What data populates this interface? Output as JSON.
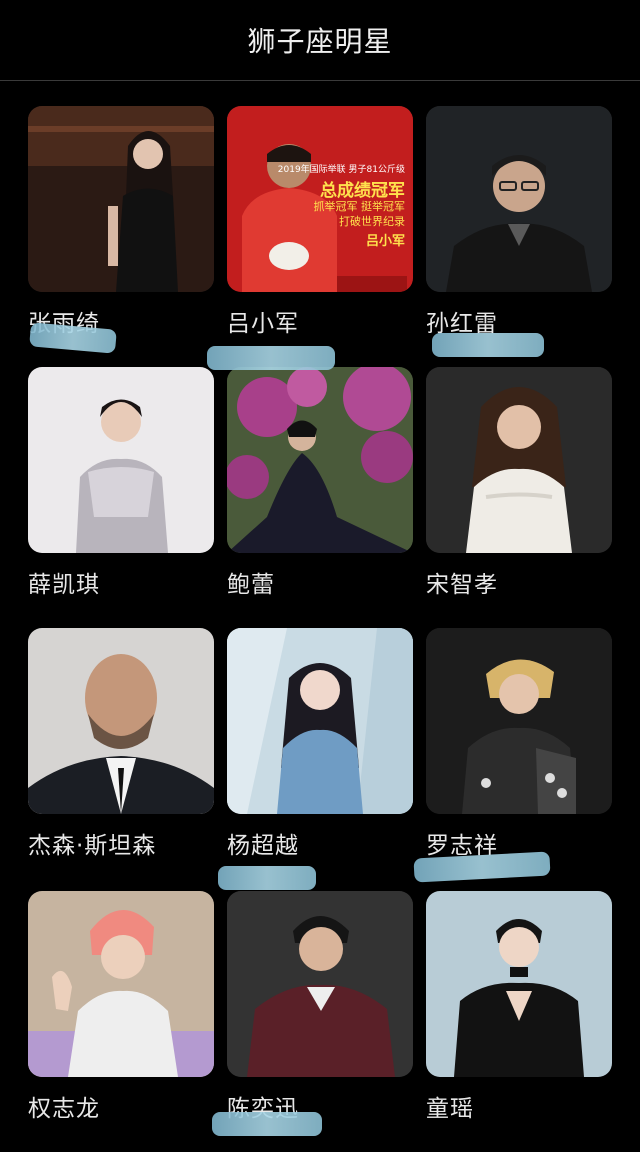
{
  "header": {
    "title": "狮子座明星"
  },
  "celebrities": [
    {
      "name": "张雨绮"
    },
    {
      "name": "吕小军"
    },
    {
      "name": "孙红雷"
    },
    {
      "name": "薛凯琪"
    },
    {
      "name": "鲍蕾"
    },
    {
      "name": "宋智孝"
    },
    {
      "name": "杰森·斯坦森"
    },
    {
      "name": "杨超越"
    },
    {
      "name": "罗志祥"
    },
    {
      "name": "权志龙"
    },
    {
      "name": "陈奕迅"
    },
    {
      "name": "童瑶"
    }
  ],
  "poster": {
    "headline": "总成绩冠军",
    "line1": "抓举冠军 挺举冠军",
    "line2": "打破世界纪录",
    "signature": "吕小军",
    "small": "2019年国际举联 男子81公斤级"
  }
}
